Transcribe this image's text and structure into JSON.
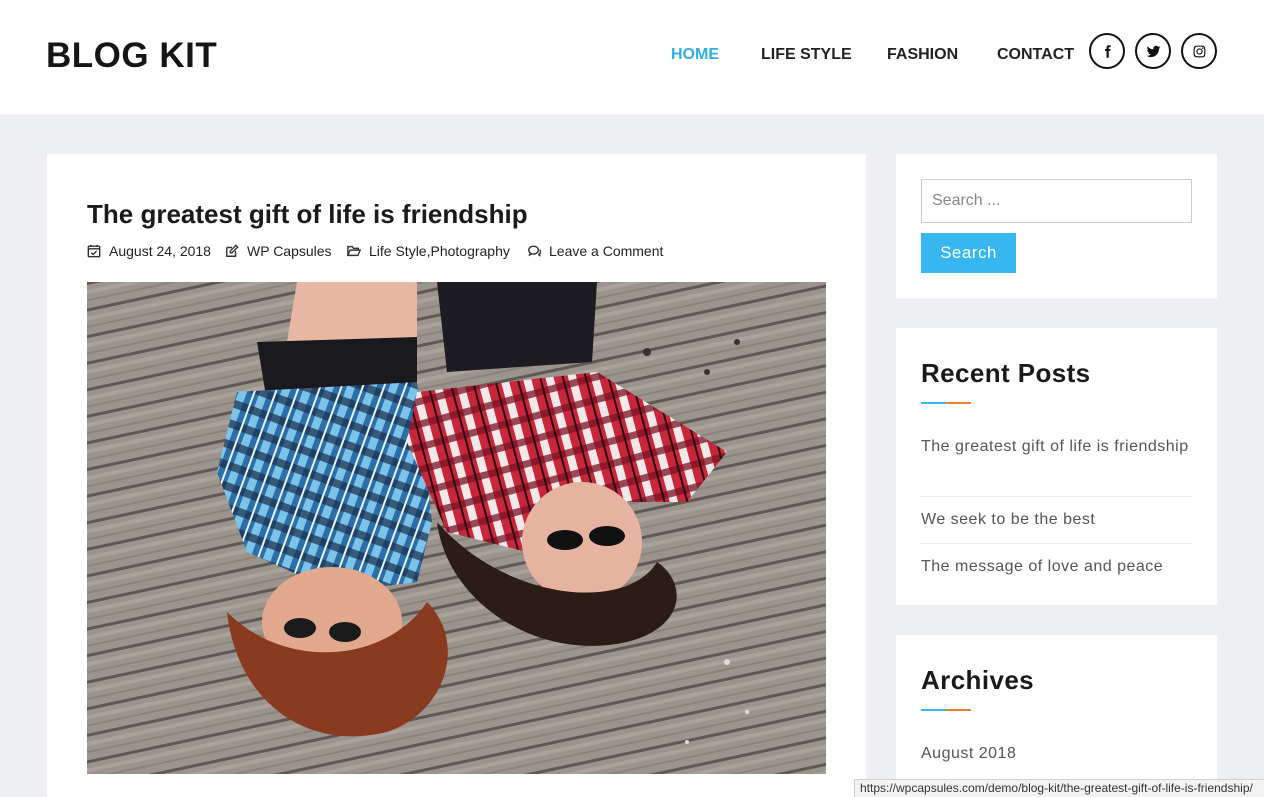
{
  "site": {
    "logo": "BLOG KIT"
  },
  "nav": {
    "items": [
      {
        "label": "HOME",
        "active": true
      },
      {
        "label": "LIFE STYLE",
        "active": false
      },
      {
        "label": "FASHION",
        "active": false
      },
      {
        "label": "CONTACT",
        "active": false
      }
    ],
    "accent_color": "#33aee5"
  },
  "social": [
    {
      "icon": "facebook-icon"
    },
    {
      "icon": "twitter-icon"
    },
    {
      "icon": "instagram-icon"
    }
  ],
  "post": {
    "title": "The greatest gift of life is friendship",
    "date": "August 24, 2018",
    "author": "WP Capsules",
    "category_1": "Life Style",
    "category_sep": ",",
    "category_2": "Photography",
    "comments": "Leave a Comment"
  },
  "search": {
    "placeholder": "Search ...",
    "button_label": "Search"
  },
  "recent_posts": {
    "title": "Recent Posts",
    "items": [
      "The greatest gift of life is friendship",
      "We seek to be the best",
      "The message of love and peace"
    ]
  },
  "archives": {
    "title": "Archives",
    "items": [
      "August 2018"
    ]
  },
  "status_bar": {
    "url": "https://wpcapsules.com/demo/blog-kit/the-greatest-gift-of-life-is-friendship/"
  },
  "colors": {
    "accent_blue": "#36b7f0",
    "accent_orange": "#f07a32",
    "page_bg": "#eeeff3"
  }
}
